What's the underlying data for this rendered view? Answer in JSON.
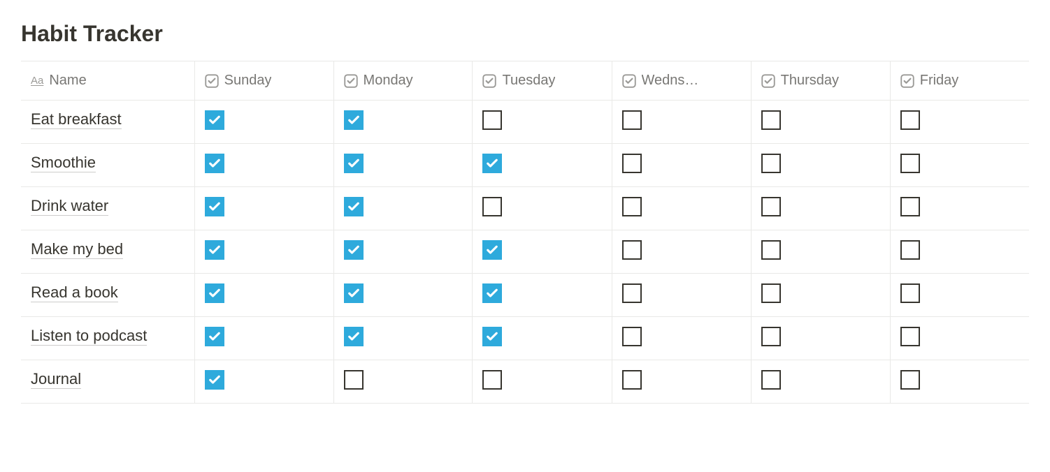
{
  "title": "Habit Tracker",
  "columns": [
    {
      "key": "name",
      "label": "Name",
      "type": "title"
    },
    {
      "key": "sun",
      "label": "Sunday",
      "type": "checkbox"
    },
    {
      "key": "mon",
      "label": "Monday",
      "type": "checkbox"
    },
    {
      "key": "tue",
      "label": "Tuesday",
      "type": "checkbox"
    },
    {
      "key": "wed",
      "label": "Wedns…",
      "type": "checkbox"
    },
    {
      "key": "thu",
      "label": "Thursday",
      "type": "checkbox"
    },
    {
      "key": "fri",
      "label": "Friday",
      "type": "checkbox"
    }
  ],
  "rows": [
    {
      "name": "Eat breakfast",
      "sun": true,
      "mon": true,
      "tue": false,
      "wed": false,
      "thu": false,
      "fri": false
    },
    {
      "name": "Smoothie",
      "sun": true,
      "mon": true,
      "tue": true,
      "wed": false,
      "thu": false,
      "fri": false
    },
    {
      "name": "Drink water",
      "sun": true,
      "mon": true,
      "tue": false,
      "wed": false,
      "thu": false,
      "fri": false
    },
    {
      "name": "Make my bed",
      "sun": true,
      "mon": true,
      "tue": true,
      "wed": false,
      "thu": false,
      "fri": false
    },
    {
      "name": "Read a book",
      "sun": true,
      "mon": true,
      "tue": true,
      "wed": false,
      "thu": false,
      "fri": false
    },
    {
      "name": "Listen to podcast",
      "sun": true,
      "mon": true,
      "tue": true,
      "wed": false,
      "thu": false,
      "fri": false
    },
    {
      "name": "Journal",
      "sun": true,
      "mon": false,
      "tue": false,
      "wed": false,
      "thu": false,
      "fri": false
    }
  ]
}
